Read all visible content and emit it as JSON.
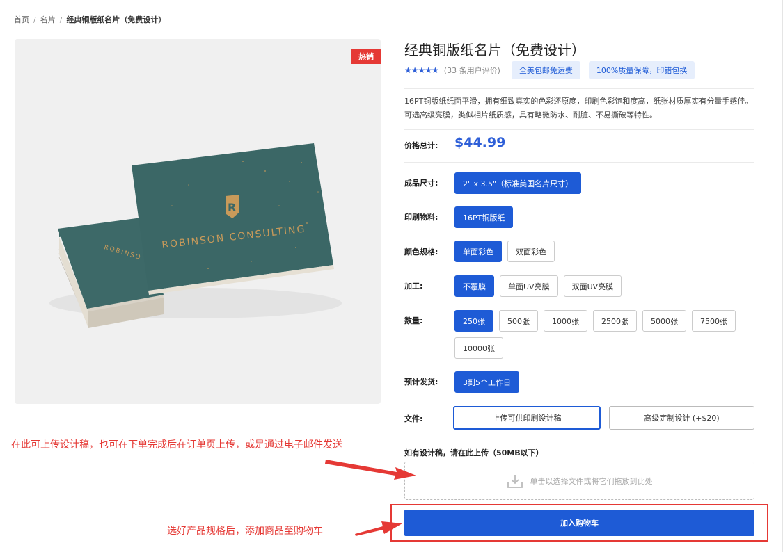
{
  "breadcrumb": {
    "home": "首页",
    "category": "名片",
    "current": "经典铜版纸名片（免费设计）"
  },
  "product": {
    "hot_badge": "热销",
    "title": "经典铜版纸名片（免费设计）",
    "stars": "★★★★★",
    "review_count": "(33 条用户评价)",
    "tags": [
      "全美包邮免运费",
      "100%质量保障，印错包换"
    ],
    "description": "16PT铜版纸纸面平滑，拥有细致真实的色彩还原度，印刷色彩饱和度高，纸张材质厚实有分量手感佳。可选高级亮膜，类似相片纸质感，具有略微防水、耐脏、不易撕破等特性。",
    "rating": 5,
    "card_text": "ROBINSON CONSULTING",
    "card_logo_letter": "R"
  },
  "price": {
    "label": "价格总计:",
    "value": "$44.99"
  },
  "options": {
    "size": {
      "label": "成品尺寸:",
      "items": [
        "2\" x 3.5\"（标准美国名片尺寸）"
      ],
      "selected": 0
    },
    "material": {
      "label": "印刷物料:",
      "items": [
        "16PT铜版纸"
      ],
      "selected": 0
    },
    "color": {
      "label": "颜色规格:",
      "items": [
        "单面彩色",
        "双面彩色"
      ],
      "selected": 0
    },
    "finish": {
      "label": "加工:",
      "items": [
        "不覆膜",
        "单面UV亮膜",
        "双面UV亮膜"
      ],
      "selected": 0
    },
    "quantity": {
      "label": "数量:",
      "items": [
        "250张",
        "500张",
        "1000张",
        "2500张",
        "5000张",
        "7500张",
        "10000张"
      ],
      "selected": 0
    },
    "shipping": {
      "label": "预计发货:",
      "items": [
        "3到5个工作日"
      ],
      "selected": 0
    }
  },
  "file": {
    "label": "文件:",
    "upload_button": "上传可供印刷设计稿",
    "design_button": "高级定制设计 (+$20)",
    "upload_title": "如有设计稿，请在此上传（50MB以下）",
    "dropzone_text": "单击以选择文件或将它们拖放到此处"
  },
  "cart": {
    "button": "加入购物车"
  },
  "annotations": {
    "upload_note": "在此可上传设计稿，也可在下单完成后在订单页上传，或是通过电子邮件发送",
    "cart_note": "选好产品规格后，添加商品至购物车"
  },
  "colors": {
    "accent": "#1e5bd6",
    "price": "#2e5fd8",
    "badge": "#e53935",
    "annotation": "#e53935",
    "card": "#3b6766",
    "card_gold": "#c89a5a"
  }
}
